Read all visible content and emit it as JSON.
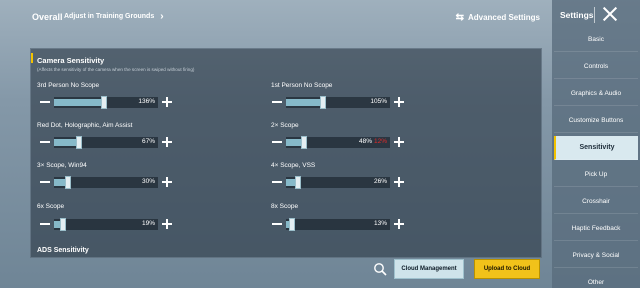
{
  "topbar": {
    "overall": "Overall",
    "adjust": "Adjust in Training Grounds",
    "advanced": "Advanced Settings"
  },
  "camera": {
    "title": "Camera Sensitivity",
    "subtitle": "(Affects the sensitivity of the camera when the screen is swiped without firing)",
    "rows": [
      {
        "label": "3rd Person No Scope",
        "value": "136%",
        "fraction": 0.48
      },
      {
        "label": "1st Person No Scope",
        "value": "105%",
        "fraction": 0.36
      },
      {
        "label": "Red Dot, Holographic, Aim Assist",
        "value": "67%",
        "fraction": 0.24
      },
      {
        "label": "2× Scope",
        "value": "48%",
        "extra": "12%",
        "fraction": 0.17
      },
      {
        "label": "3× Scope, Win94",
        "value": "30%",
        "fraction": 0.13
      },
      {
        "label": "4× Scope, VSS",
        "value": "26%",
        "fraction": 0.12
      },
      {
        "label": "6x Scope",
        "value": "19%",
        "fraction": 0.09
      },
      {
        "label": "8x Scope",
        "value": "13%",
        "fraction": 0.06
      }
    ]
  },
  "ads": {
    "title": "ADS Sensitivity"
  },
  "buttons": {
    "cloud_management": "Cloud Management",
    "upload": "Upload to Cloud"
  },
  "sidebar": {
    "title": "Settings",
    "items": [
      {
        "label": "Basic"
      },
      {
        "label": "Controls"
      },
      {
        "label": "Graphics & Audio"
      },
      {
        "label": "Customize Buttons"
      },
      {
        "label": "Sensitivity",
        "active": true
      },
      {
        "label": "Pick Up"
      },
      {
        "label": "Crosshair"
      },
      {
        "label": "Haptic Feedback"
      },
      {
        "label": "Privacy & Social"
      },
      {
        "label": "Other"
      }
    ]
  },
  "colors": {
    "accent": "#f2c200",
    "slider_fill": "#86b9c9",
    "warning_value": "#e02a2a"
  },
  "icons": [
    "swap-icon",
    "chevron-right-icon",
    "close-icon",
    "search-icon",
    "minus-icon",
    "plus-icon"
  ]
}
